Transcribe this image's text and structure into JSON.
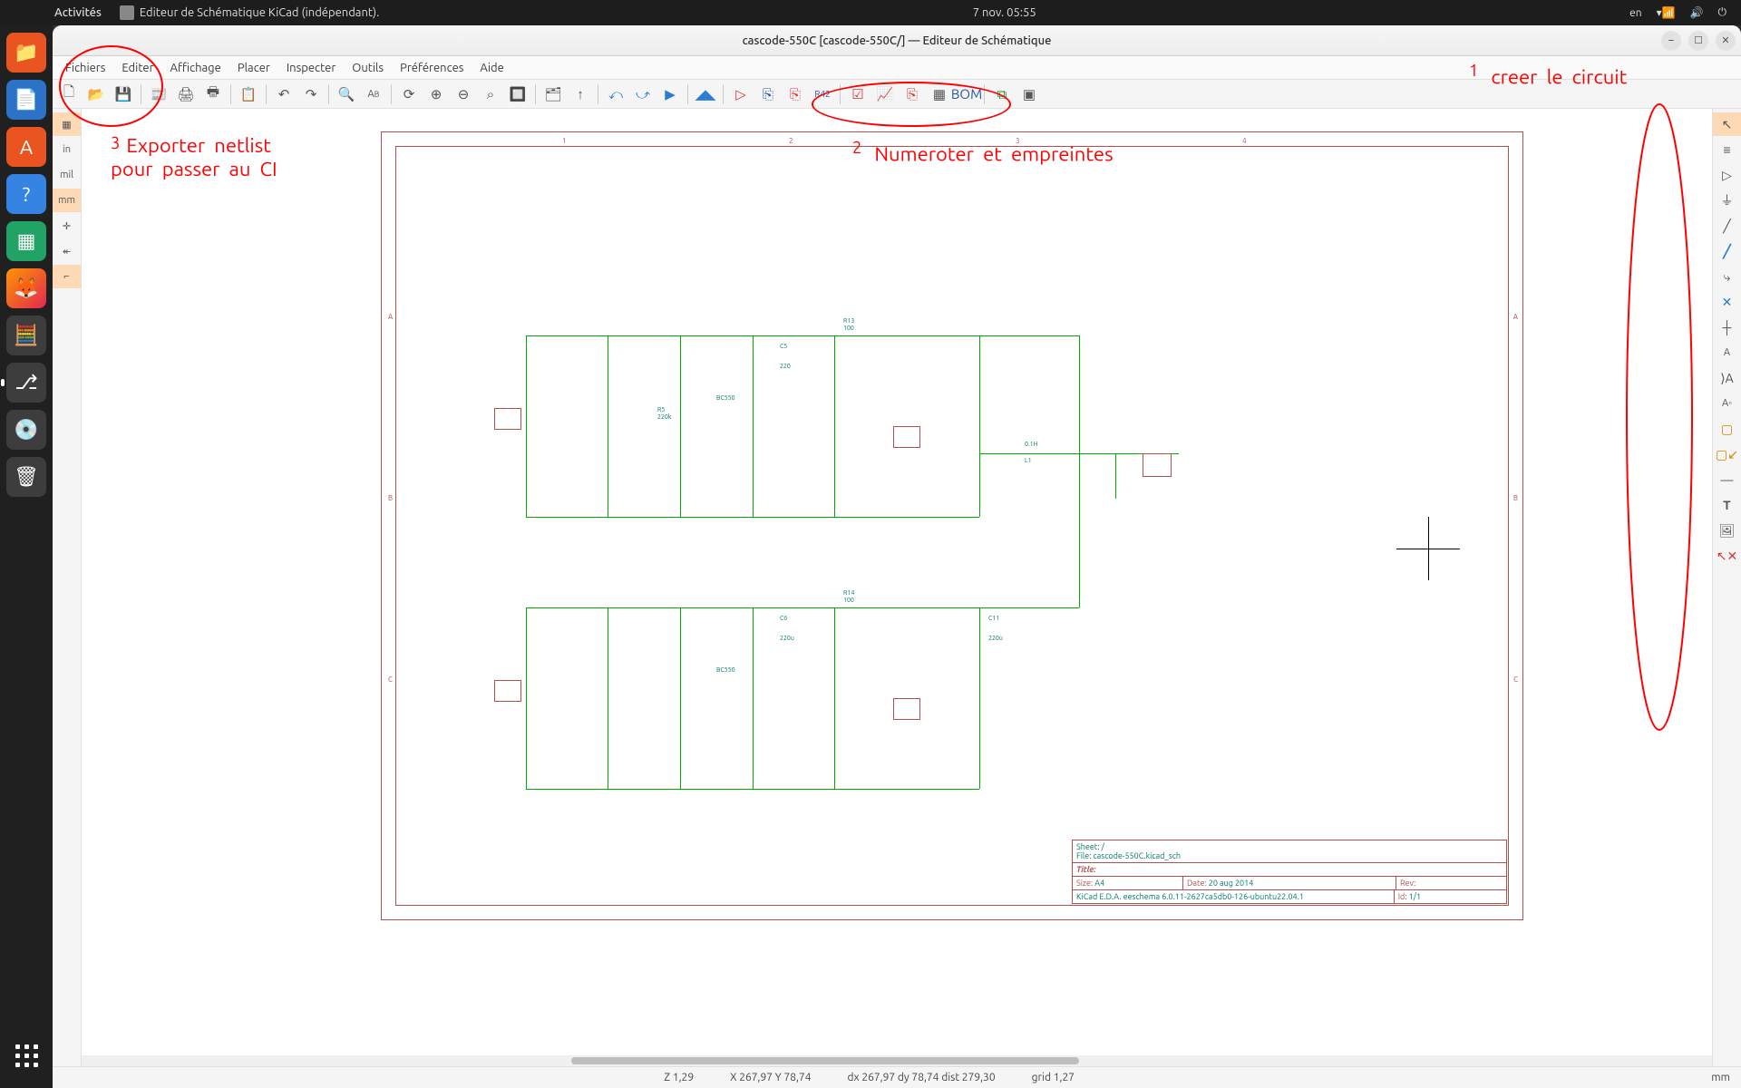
{
  "gnome": {
    "activities": "Activités",
    "app_name": "Editeur de Schématique KiCad (indépendant).",
    "date_time": "7 nov.  05:55",
    "lang_indicator": "en"
  },
  "window": {
    "title": "cascode-550C [cascode-550C/] — Editeur de Schématique"
  },
  "menu": {
    "items": [
      "Fichiers",
      "Editer",
      "Affichage",
      "Placer",
      "Inspecter",
      "Outils",
      "Préférences",
      "Aide"
    ]
  },
  "left_tools": {
    "grid": "▦",
    "units_in": "in",
    "units_mil": "mil",
    "units_mm": "mm",
    "cursor": "✛",
    "hidden_pins": "↞",
    "origin": "⌐"
  },
  "title_block": {
    "sheet": "Sheet: /",
    "file": "File: cascode-550C.kicad_sch",
    "title_lbl": "Title:",
    "size_lbl": "Size:",
    "size_val": "A4",
    "date_lbl": "Date:",
    "date_val": "20 aug 2014",
    "rev_lbl": "Rev:",
    "id_lbl": "Id:",
    "id_val": "1/1",
    "generator": "KiCad E.D.A.  eeschema  6.0.11-2627ca5db0-126-ubuntu22.04.1"
  },
  "schematic_labels": {
    "transistor": "BC550",
    "r13": "R13",
    "r13v": "100",
    "r14": "R14",
    "r14v": "100",
    "c5": "C5",
    "c5v": "220",
    "c6": "C6",
    "c6v": "220u",
    "c11": "C11",
    "c11v": "220u",
    "l1": "L1",
    "l1v": "0.1H",
    "r5": "R5",
    "r5v": "220k"
  },
  "status": {
    "zoom": "Z 1,29",
    "xy": "X 267,97  Y 78,74",
    "dxy": "dx 267,97  dy 78,74  dist 279,30",
    "grid": "grid 1,27",
    "unit": "mm"
  },
  "annotations": {
    "a1_num": "1",
    "a1": "creer  le  circuit",
    "a2_num": "2",
    "a2": "Numeroter  et  empreintes",
    "a3_num": "3",
    "a3": "Exporter  netlist\npour  passer  au  CI"
  }
}
